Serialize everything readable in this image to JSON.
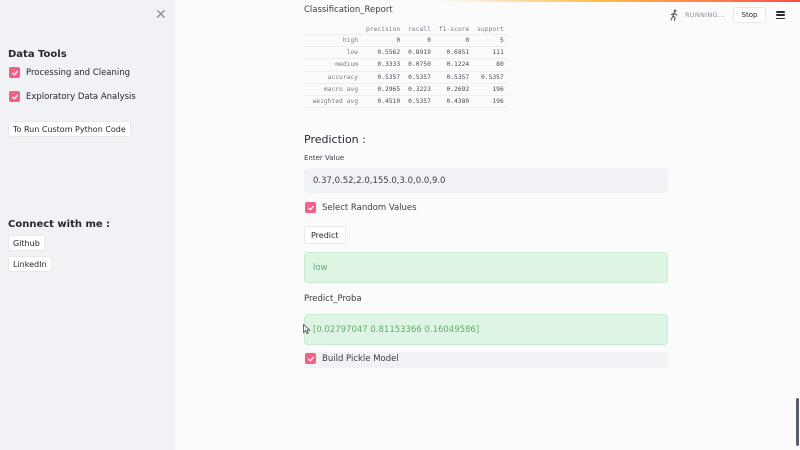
{
  "sidebar": {
    "close_icon": "close-icon",
    "data_tools_heading": "Data Tools",
    "checks": [
      {
        "label": "Processing and Cleaning",
        "checked": true
      },
      {
        "label": "Exploratory Data Analysis",
        "checked": true
      }
    ],
    "custom_code_button": "To Run Custom Python Code",
    "connect_heading": "Connect with me :",
    "github_button": "Github",
    "linkedin_button": "LinkedIn"
  },
  "header": {
    "status_text": "RUNNING...",
    "status_icon": "running-man-icon",
    "stop_button": "Stop",
    "menu_icon": "hamburger-menu-icon"
  },
  "report": {
    "title": "Classification_Report",
    "columns": [
      "precision",
      "recall",
      "f1-score",
      "support"
    ],
    "rows": [
      {
        "label": "high",
        "values": [
          "0",
          "0",
          "0",
          "5"
        ]
      },
      {
        "label": "low",
        "values": [
          "0.5562",
          "0.8919",
          "0.6851",
          "111"
        ]
      },
      {
        "label": "medium",
        "values": [
          "0.3333",
          "0.0750",
          "0.1224",
          "80"
        ]
      },
      {
        "label": "accuracy",
        "values": [
          "0.5357",
          "0.5357",
          "0.5357",
          "0.5357"
        ]
      },
      {
        "label": "macro avg",
        "values": [
          "0.2965",
          "0.3223",
          "0.2692",
          "196"
        ]
      },
      {
        "label": "weighted avg",
        "values": [
          "0.4510",
          "0.5357",
          "0.4380",
          "196"
        ]
      }
    ]
  },
  "prediction": {
    "title": "Prediction :",
    "input_label": "Enter Value",
    "input_value": "0.37,0.52,2.0,155.0,3.0,0.0,9.0",
    "random_values_label": "Select Random Values",
    "random_values_checked": true,
    "predict_button": "Predict",
    "predict_result": "low",
    "proba_label": "Predict_Proba",
    "proba_result": "[0.02797047 0.81153366 0.16049586]",
    "pickle_label": "Build Pickle Model",
    "pickle_checked": true
  },
  "colors": {
    "checkbox_accent": "#f55f87",
    "success_bg": "#dff5e4",
    "success_text": "#5cab72",
    "sidebar_bg": "#f0f2f6"
  }
}
